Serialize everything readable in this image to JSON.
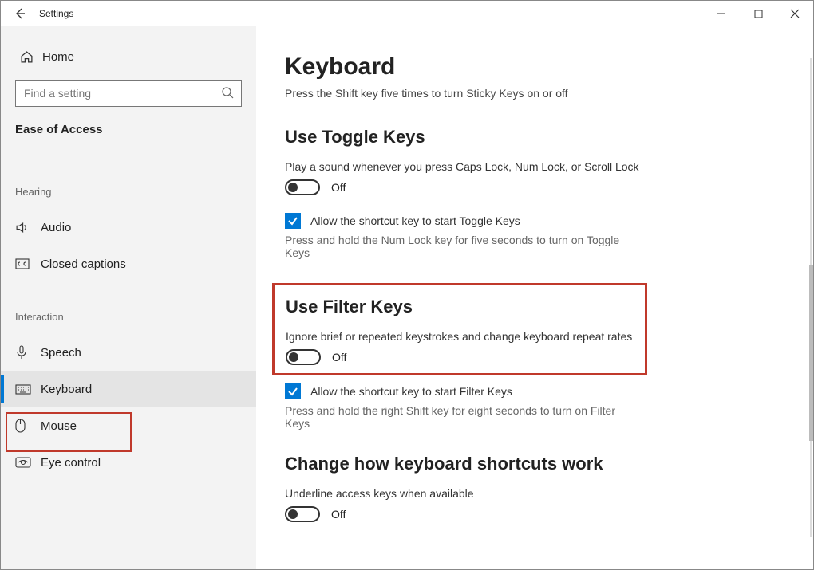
{
  "titlebar": {
    "title": "Settings"
  },
  "sidebar": {
    "home": "Home",
    "search_placeholder": "Find a setting",
    "category": "Ease of Access",
    "groups": {
      "hearing": {
        "label": "Hearing",
        "items": [
          {
            "label": "Audio"
          },
          {
            "label": "Closed captions"
          }
        ]
      },
      "interaction": {
        "label": "Interaction",
        "items": [
          {
            "label": "Speech"
          },
          {
            "label": "Keyboard"
          },
          {
            "label": "Mouse"
          },
          {
            "label": "Eye control"
          }
        ]
      }
    }
  },
  "page": {
    "title": "Keyboard",
    "sticky_hint": "Press the Shift key five times to turn Sticky Keys on or off",
    "toggle_keys": {
      "heading": "Use Toggle Keys",
      "desc": "Play a sound whenever you press Caps Lock, Num Lock, or Scroll Lock",
      "state": "Off",
      "allow_label": "Allow the shortcut key to start Toggle Keys",
      "hint": "Press and hold the Num Lock key for five seconds to turn on Toggle Keys"
    },
    "filter_keys": {
      "heading": "Use Filter Keys",
      "desc": "Ignore brief or repeated keystrokes and change keyboard repeat rates",
      "state": "Off",
      "allow_label": "Allow the shortcut key to start Filter Keys",
      "hint": "Press and hold the right Shift key for eight seconds to turn on Filter Keys"
    },
    "shortcuts": {
      "heading": "Change how keyboard shortcuts work",
      "desc": "Underline access keys when available",
      "state": "Off"
    }
  }
}
